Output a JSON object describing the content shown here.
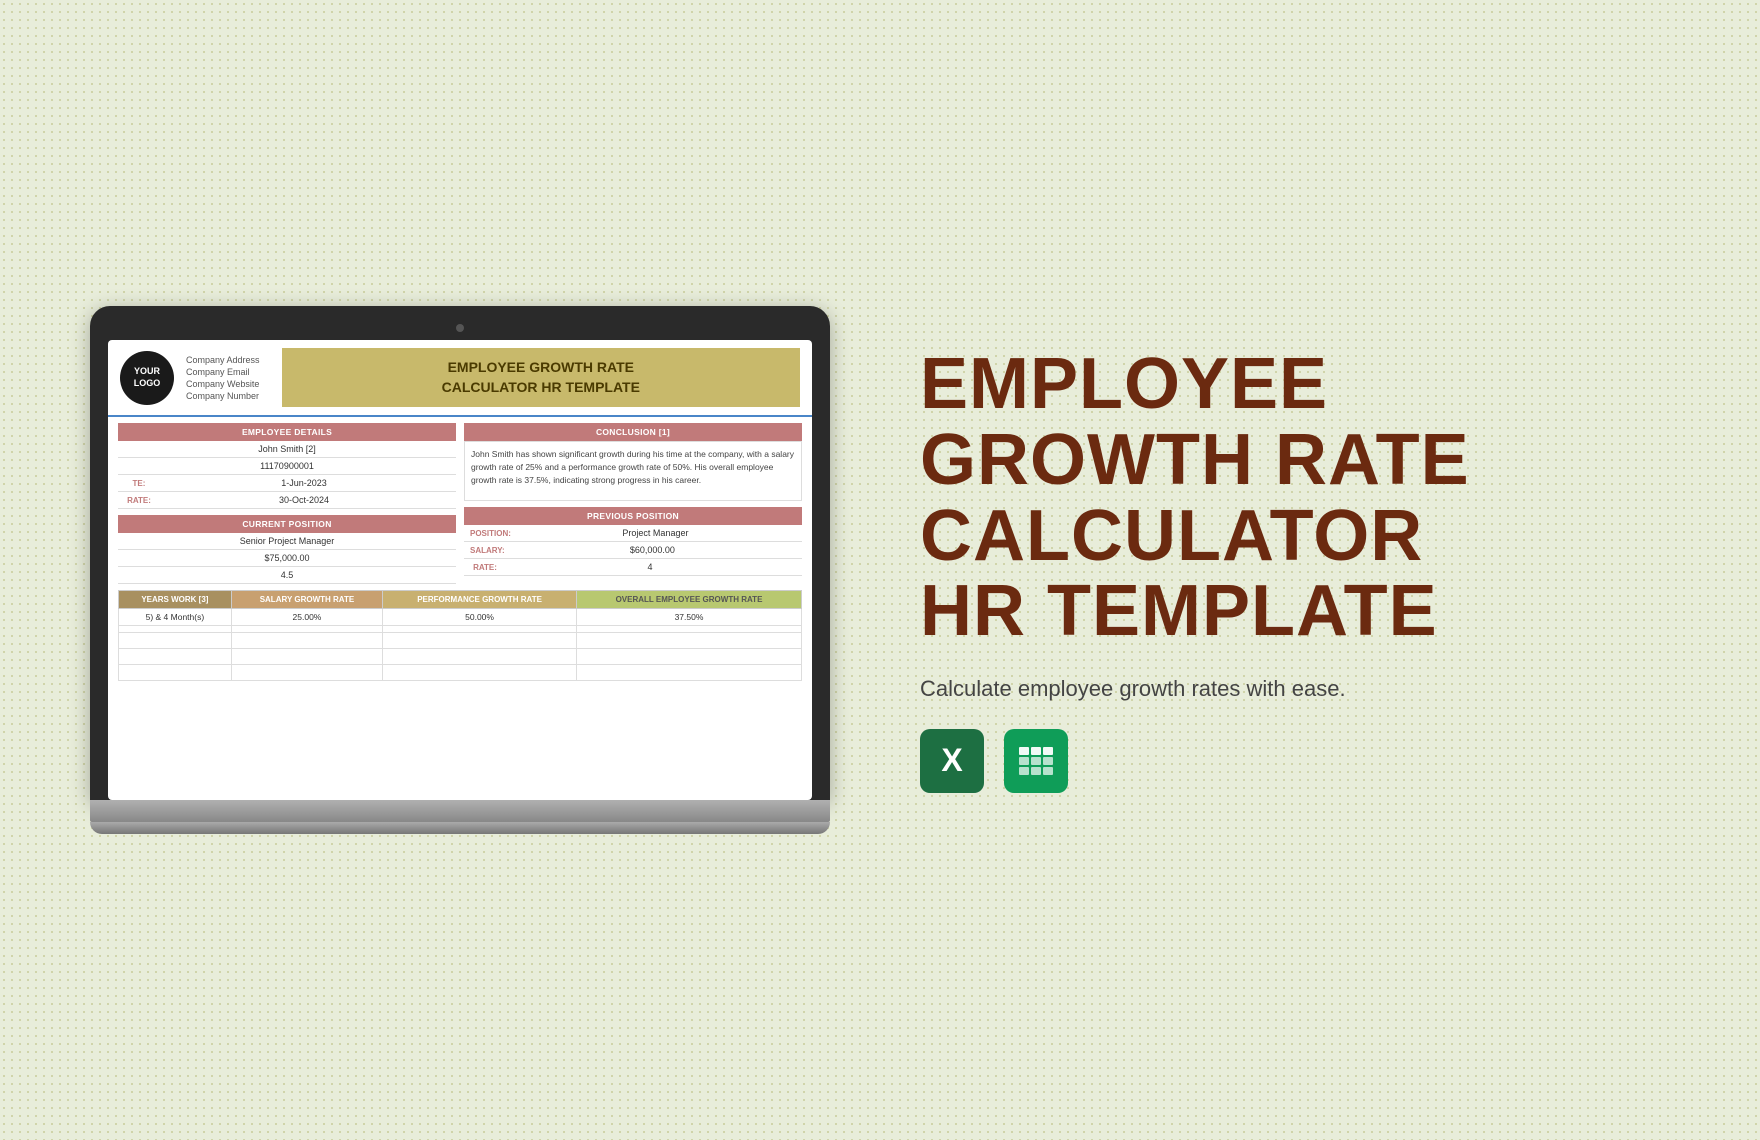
{
  "background": "#e8edda",
  "laptop": {
    "header": {
      "logo": {
        "line1": "YOUR",
        "line2": "LOGO"
      },
      "company_fields": [
        "Company Address",
        "Company Email",
        "Company Website",
        "Company Number"
      ],
      "title_line1": "EMPLOYEE GROWTH RATE",
      "title_line2": "CALCULATOR HR TEMPLATE"
    },
    "employee_details": {
      "section_label": "EMPLOYEE DETAILS",
      "name": "John Smith [2]",
      "id": "11170900001",
      "date_label": "TE:",
      "date_value": "1-Jun-2023",
      "rate_label": "RATE:",
      "rate_value": "30-Oct-2024"
    },
    "conclusion": {
      "section_label": "CONCLUSION [1]",
      "text": "John Smith has shown significant growth during his time at the company, with a salary growth rate of 25% and a performance growth rate of 50%. His overall employee growth rate is 37.5%, indicating strong progress in his career."
    },
    "current_position": {
      "section_label": "CURRENT POSITION",
      "title": "Senior Project Manager",
      "salary": "$75,000.00",
      "rating": "4.5"
    },
    "previous_position": {
      "section_label": "PREVIOUS POSITION",
      "position_label": "POSITION:",
      "position_value": "Project Manager",
      "salary_label": "SALARY:",
      "salary_value": "$60,000.00",
      "rate_label": "RATE:",
      "rate_value": "4"
    },
    "bottom_table": {
      "headers": [
        "YEARS WORK [3]",
        "SALARY GROWTH RATE",
        "PERFORMANCE GROWTH RATE",
        "OVERALL EMPLOYEE GROWTH RATE"
      ],
      "rows": [
        [
          "5) & 4 Month(s)",
          "25.00%",
          "50.00%",
          "37.50%"
        ],
        [
          "",
          "",
          "",
          ""
        ],
        [
          "",
          "",
          "",
          ""
        ],
        [
          "",
          "",
          "",
          ""
        ],
        [
          "",
          "",
          "",
          ""
        ]
      ]
    }
  },
  "right": {
    "title_line1": "EMPLOYEE",
    "title_line2": "GROWTH RATE",
    "title_line3": "CALCULATOR",
    "title_line4": "HR TEMPLATE",
    "subtitle": "Calculate employee growth rates with ease.",
    "icons": [
      {
        "name": "excel",
        "label": "Excel"
      },
      {
        "name": "sheets",
        "label": "Google Sheets"
      }
    ]
  }
}
